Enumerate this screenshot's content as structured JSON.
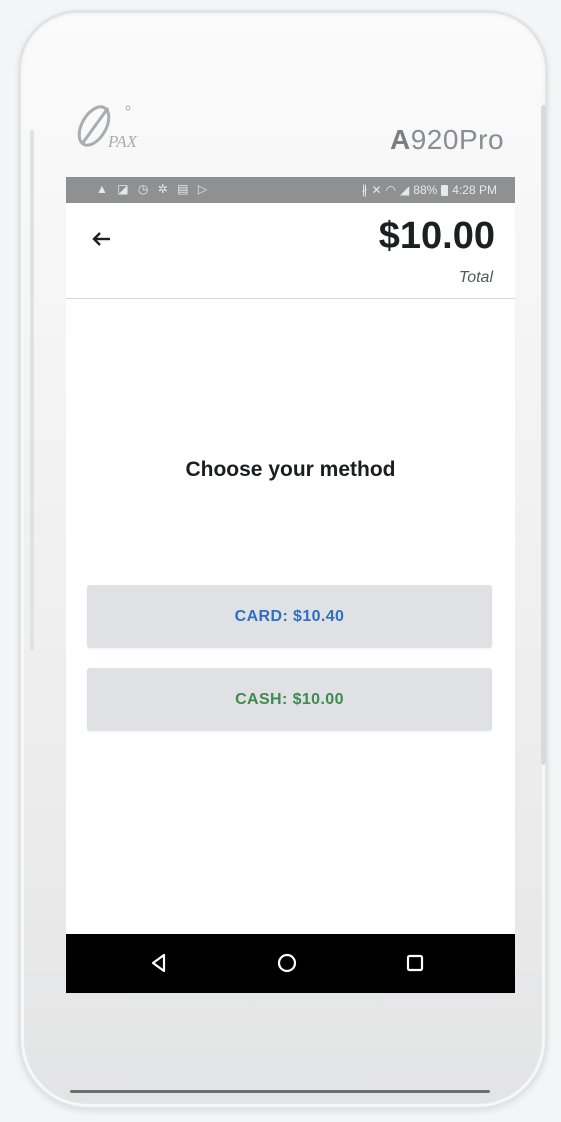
{
  "device": {
    "brand_logo_text": "PAX",
    "model_prefix": "A",
    "model_suffix": "920Pro"
  },
  "status_bar": {
    "left_icons": [
      "warning-icon",
      "screen-icon",
      "sync-icon",
      "settings-icon",
      "clipboard-icon",
      "play-icon"
    ],
    "battery_percent": "88%",
    "time": "4:28 PM"
  },
  "header": {
    "total_amount": "$10.00",
    "total_label": "Total"
  },
  "main": {
    "prompt": "Choose your method",
    "methods": [
      {
        "label": "CARD: $10.40",
        "color": "#2f6fc2"
      },
      {
        "label": "CASH: $10.00",
        "color": "#3f8a4c"
      }
    ]
  },
  "nav_bar": {
    "buttons": [
      "back-icon",
      "home-icon",
      "recents-icon"
    ]
  },
  "colors": {
    "status_bar": "#8e9092",
    "button_bg": "#dfe1e4",
    "nav_bg": "#000000"
  }
}
